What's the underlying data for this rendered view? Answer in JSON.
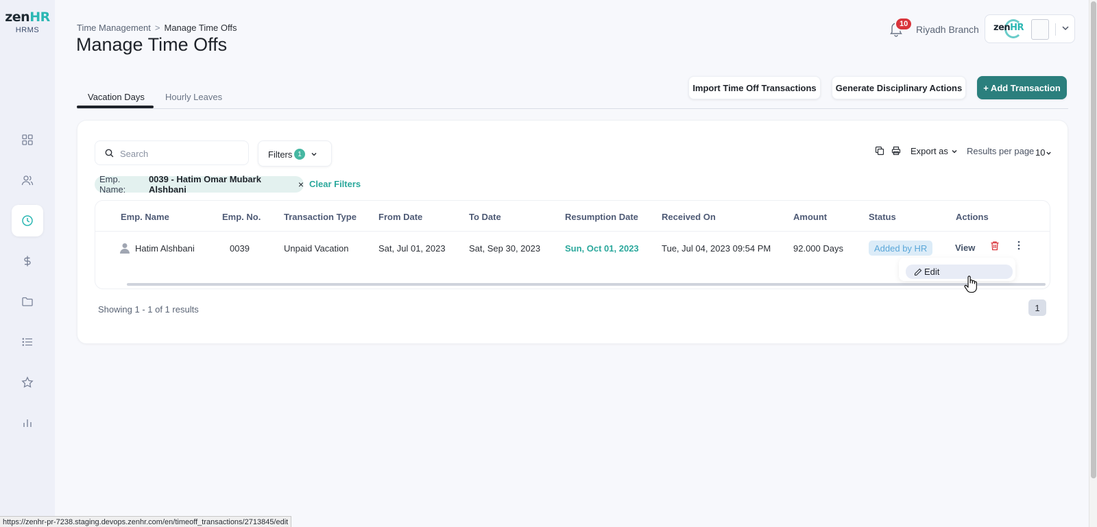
{
  "app": {
    "brand_main": "zen",
    "brand_accent": "HR",
    "brand_sub": "HRMS"
  },
  "sidebar": {
    "items": [
      {
        "name": "dashboard",
        "icon": "grid-icon"
      },
      {
        "name": "employees",
        "icon": "users-icon"
      },
      {
        "name": "time",
        "icon": "clock-icon",
        "active": true
      },
      {
        "name": "payroll",
        "icon": "dollar-icon"
      },
      {
        "name": "documents",
        "icon": "folder-icon"
      },
      {
        "name": "lists",
        "icon": "list-icon"
      },
      {
        "name": "favorites",
        "icon": "star-icon"
      },
      {
        "name": "reports",
        "icon": "bar-chart-icon"
      }
    ]
  },
  "header": {
    "breadcrumb_parent": "Time Management",
    "breadcrumb_sep": ">",
    "breadcrumb_current": "Manage Time Offs",
    "title": "Manage Time Offs",
    "notifications_count": "10",
    "branch": "Riyadh Branch",
    "account_logo_main": "zen",
    "account_logo_accent": "HR"
  },
  "tabs": [
    {
      "label": "Vacation Days",
      "active": true
    },
    {
      "label": "Hourly Leaves",
      "active": false
    }
  ],
  "actions": {
    "import": "Import Time Off Transactions",
    "generate": "Generate Disciplinary Actions",
    "add": "+ Add Transaction"
  },
  "toolbar": {
    "search_placeholder": "Search",
    "filters_label": "Filters",
    "filters_count": "1",
    "export_label": "Export as",
    "rpp_label": "Results per page",
    "rpp_value": "10"
  },
  "active_filter": {
    "label": "Emp. Name:",
    "value": "0039 - Hatim Omar Mubark Alshbani",
    "remove": "×",
    "clear": "Clear Filters"
  },
  "table": {
    "columns": [
      "Emp. Name",
      "Emp. No.",
      "Transaction Type",
      "From Date",
      "To Date",
      "Resumption Date",
      "Received On",
      "Amount",
      "Status",
      "Actions"
    ],
    "rows": [
      {
        "emp_name": "Hatim Alshbani",
        "emp_no": "0039",
        "type": "Unpaid Vacation",
        "from": "Sat, Jul 01, 2023",
        "to": "Sat, Sep 30, 2023",
        "resumption": "Sun, Oct 01, 2023",
        "received": "Tue, Jul 04, 2023 09:54 PM",
        "amount": "92.000 Days",
        "status": "Added by HR",
        "view": "View"
      }
    ]
  },
  "row_menu": {
    "edit": "Edit"
  },
  "footer": {
    "showing": "Showing 1 - 1 of 1 results",
    "page": "1"
  },
  "browser": {
    "status_url": "https://zenhr-pr-7238.staging.devops.zenhr.com/en/timeoff_transactions/2713845/edit"
  },
  "colors": {
    "accent": "#2bb7b3",
    "primary_button": "#2b7f7d",
    "danger": "#d9343b",
    "status_bg": "#dcecf8",
    "status_text": "#5aa7d9"
  }
}
